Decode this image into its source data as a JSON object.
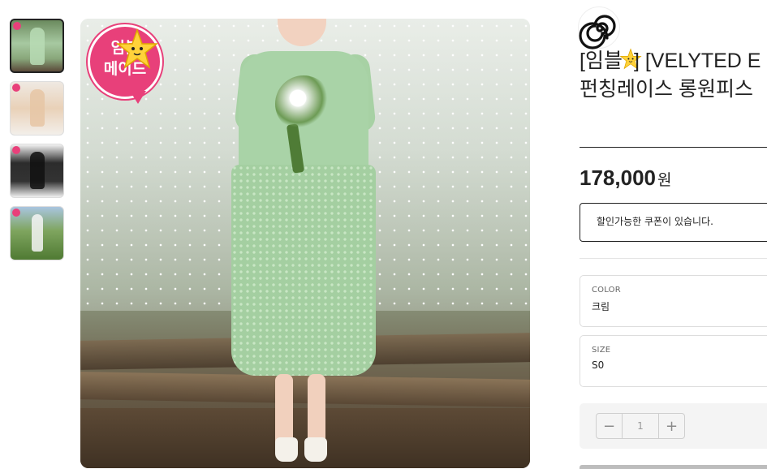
{
  "thumbnails": [
    {
      "alt": "green lace dress front view",
      "active": true,
      "badge": "promo"
    },
    {
      "alt": "cream dress side view",
      "active": false,
      "badge": "promo"
    },
    {
      "alt": "black dress full view",
      "active": false,
      "badge": "promo"
    },
    {
      "alt": "white dress in field",
      "active": false,
      "badge": "promo"
    }
  ],
  "promo_badge": {
    "text_line1": "임블",
    "text_line2": "메이드",
    "color": "#e8407a",
    "icon": "star-face-icon"
  },
  "brand": {
    "logo_icon": "spiral-logo-icon"
  },
  "product": {
    "title_prefix": "[임블",
    "title_rest": "] [VELYTED E",
    "title_line2": "펀칭레이스 롱원피스",
    "price": "178,000",
    "currency": "원"
  },
  "coupon": {
    "text": "할인가능한 쿠폰이 있습니다."
  },
  "options": {
    "color": {
      "label": "COLOR",
      "value": "크림"
    },
    "size": {
      "label": "SIZE",
      "value": "S0"
    }
  },
  "quantity": {
    "value": "1",
    "minus": "−",
    "plus": "+"
  },
  "colors": {
    "accent": "#e8407a",
    "text": "#222222",
    "border": "#dddddd",
    "panel_bg": "#f4f4f4"
  }
}
